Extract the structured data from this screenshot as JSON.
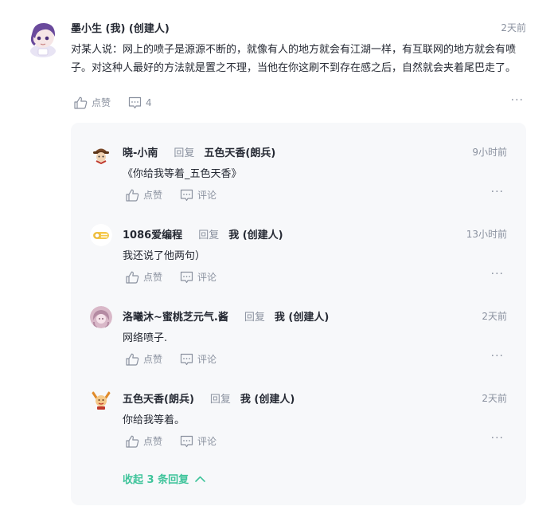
{
  "comment": {
    "author": "墨小生 (我) (创建人)",
    "time": "2天前",
    "text": "对某人说：网上的喷子是源源不断的，就像有人的地方就会有江湖一样，有互联网的地方就会有喷子。对这种人最好的方法就是置之不理，当他在你这刷不到存在感之后，自然就会夹着尾巴走了。",
    "like_label": "点赞",
    "comment_count": "4",
    "more": "···"
  },
  "replies": [
    {
      "user": "晓-小南",
      "reply_word": "回复",
      "target": "五色天香(朗兵)",
      "time": "9小时前",
      "text": "《你给我等着_五色天香》",
      "like_label": "点赞",
      "comment_label": "评论",
      "more": "···"
    },
    {
      "user": "1086爱编程",
      "reply_word": "回复",
      "target": "我 (创建人)",
      "time": "13小时前",
      "text": "我还说了他两句）",
      "like_label": "点赞",
      "comment_label": "评论",
      "more": "···"
    },
    {
      "user": "洛曦沐~蜜桃芝元气.酱",
      "reply_word": "回复",
      "target": "我 (创建人)",
      "time": "2天前",
      "text": "网络喷子.",
      "like_label": "点赞",
      "comment_label": "评论",
      "more": "···"
    },
    {
      "user": "五色天香(朗兵)",
      "reply_word": "回复",
      "target": "我 (创建人)",
      "time": "2天前",
      "text": "你给我等着。",
      "like_label": "点赞",
      "comment_label": "评论",
      "more": "···"
    }
  ],
  "collapse_label": "收起 3 条回复",
  "colors": {
    "accent": "#3fc49b",
    "muted": "#8a919f",
    "text": "#252933",
    "reply_bg": "#f7f8fa"
  }
}
